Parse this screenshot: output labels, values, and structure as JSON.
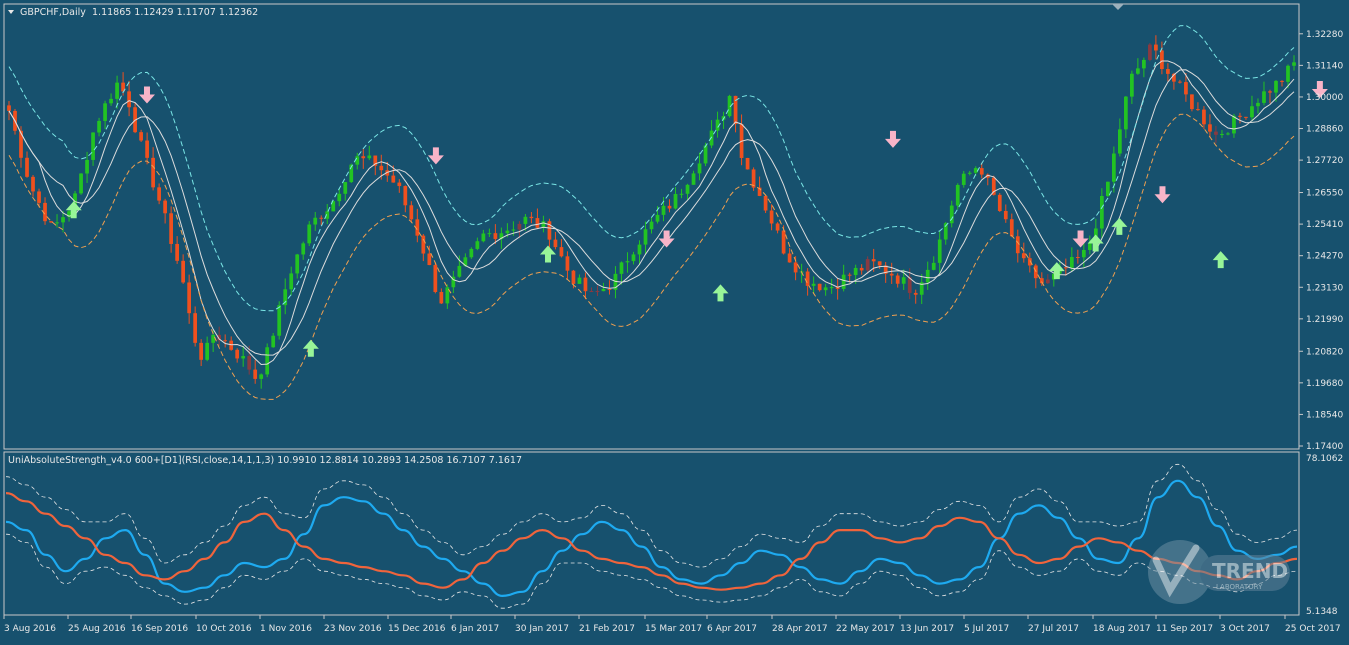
{
  "colors": {
    "background": "#17516e",
    "border": "#c8c8c8",
    "text": "#e8e8e8",
    "bull_candle": "#22c322",
    "bear_candle": "#f0501e",
    "neutral_candle": "#8a3a40",
    "envelope_upper": "#7ae6e6",
    "envelope_lower": "#f0a050",
    "mid_band": "#dcdcdc",
    "arrow_up": "#98f598",
    "arrow_down": "#f8b4c8",
    "strength_bull": "#1eaaf0",
    "strength_bear": "#f0643c",
    "strength_band": "#e6e6e6"
  },
  "header": {
    "dropdown_icon": "triangle-down-icon",
    "symbol_label": "GBPCHF,Daily",
    "ohlc": "1.11865 1.12429 1.11707 1.12362"
  },
  "indicator": {
    "label": "UniAbsoluteStrength_v4.0 600+[D1](RSI,close,14,1,1,3) 10.9910 12.8814 10.2893 14.2508 16.7107 7.1617"
  },
  "watermark": {
    "brand": "TREND",
    "sub": "LABORATORY"
  },
  "chart_data": [
    {
      "type": "candlestick",
      "title": "GBPCHF,Daily",
      "y_ticks": [
        "1.32280",
        "1.31140",
        "1.30000",
        "1.28860",
        "1.27720",
        "1.26550",
        "1.25410",
        "1.24270",
        "1.23130",
        "1.21990",
        "1.20820",
        "1.19680",
        "1.18540",
        "1.17400"
      ],
      "ylim": [
        1.174,
        1.3285
      ],
      "x_ticks": [
        "3 Aug 2016",
        "25 Aug 2016",
        "16 Sep 2016",
        "10 Oct 2016",
        "1 Nov 2016",
        "23 Nov 2016",
        "15 Dec 2016",
        "6 Jan 2017",
        "30 Jan 2017",
        "21 Feb 2017",
        "15 Mar 2017",
        "6 Apr 2017",
        "28 Apr 2017",
        "22 May 2017",
        "13 Jun 2017",
        "5 Jul 2017",
        "27 Jul 2017",
        "18 Aug 2017",
        "11 Sep 2017",
        "3 Oct 2017",
        "25 Oct 2017"
      ],
      "close_path": [
        [
          0,
          1.295
        ],
        [
          1,
          1.268
        ],
        [
          2,
          1.252
        ],
        [
          3,
          1.262
        ],
        [
          4,
          1.29
        ],
        [
          5,
          1.305
        ],
        [
          5.5,
          1.3
        ],
        [
          6,
          1.285
        ],
        [
          7,
          1.262
        ],
        [
          8,
          1.236
        ],
        [
          8.5,
          1.215
        ],
        [
          9,
          1.205
        ],
        [
          9.5,
          1.215
        ],
        [
          10,
          1.212
        ],
        [
          11,
          1.204
        ],
        [
          11.5,
          1.198
        ],
        [
          12,
          1.208
        ],
        [
          13,
          1.236
        ],
        [
          14,
          1.254
        ],
        [
          15,
          1.262
        ],
        [
          16,
          1.278
        ],
        [
          17,
          1.276
        ],
        [
          18,
          1.268
        ],
        [
          19,
          1.25
        ],
        [
          19.5,
          1.238
        ],
        [
          20,
          1.226
        ],
        [
          21,
          1.238
        ],
        [
          22,
          1.25
        ],
        [
          23,
          1.252
        ],
        [
          24,
          1.256
        ],
        [
          25,
          1.252
        ],
        [
          26,
          1.236
        ],
        [
          27,
          1.228
        ],
        [
          28,
          1.233
        ],
        [
          29,
          1.246
        ],
        [
          30,
          1.256
        ],
        [
          31,
          1.264
        ],
        [
          32,
          1.278
        ],
        [
          33,
          1.292
        ],
        [
          33.5,
          1.302
        ],
        [
          34,
          1.278
        ],
        [
          35,
          1.262
        ],
        [
          36,
          1.244
        ],
        [
          37,
          1.234
        ],
        [
          38,
          1.231
        ],
        [
          39,
          1.236
        ],
        [
          40,
          1.24
        ],
        [
          41,
          1.236
        ],
        [
          42,
          1.23
        ],
        [
          43,
          1.244
        ],
        [
          44,
          1.268
        ],
        [
          45,
          1.276
        ],
        [
          46,
          1.258
        ],
        [
          47,
          1.24
        ],
        [
          48,
          1.232
        ],
        [
          49,
          1.238
        ],
        [
          50,
          1.244
        ],
        [
          51,
          1.27
        ],
        [
          52,
          1.306
        ],
        [
          53,
          1.318
        ],
        [
          54,
          1.306
        ],
        [
          55,
          1.296
        ],
        [
          56,
          1.286
        ],
        [
          57,
          1.292
        ],
        [
          58,
          1.3
        ],
        [
          59,
          1.306
        ],
        [
          59.6,
          1.312
        ]
      ],
      "signals": {
        "up": [
          [
            3,
            1.262
          ],
          [
            14,
            1.212
          ],
          [
            25,
            1.246
          ],
          [
            33,
            1.232
          ],
          [
            48.6,
            1.24
          ],
          [
            50.4,
            1.25
          ],
          [
            51.5,
            1.256
          ],
          [
            56.2,
            1.244
          ],
          [
            63,
            1.296
          ]
        ],
        "down": [
          [
            6.4,
            1.298
          ],
          [
            19.8,
            1.276
          ],
          [
            30.5,
            1.246
          ],
          [
            41,
            1.282
          ],
          [
            49.7,
            1.246
          ],
          [
            53.5,
            1.262
          ],
          [
            60.8,
            1.3
          ]
        ]
      }
    },
    {
      "type": "line",
      "title": "UniAbsoluteStrength_v4.0 600+[D1](RSI,close,14,1,1,3)",
      "ylim": [
        5.1348,
        78.1062
      ],
      "y_ticks": [
        "78.1062",
        "5.1348"
      ],
      "series": [
        {
          "values": [
            48,
            44,
            32,
            24,
            30,
            40,
            44,
            32,
            18,
            14,
            16,
            22,
            28,
            26,
            30,
            42,
            56,
            60,
            58,
            52,
            44,
            36,
            30,
            24,
            18,
            12,
            14,
            24,
            34,
            42,
            48,
            44,
            36,
            26,
            20,
            18,
            22,
            28,
            34,
            32,
            26,
            20,
            18,
            24,
            30,
            28,
            22,
            18,
            20,
            26,
            40,
            52,
            56,
            50,
            40,
            30,
            28,
            40,
            60,
            68,
            60,
            46,
            34,
            30,
            32,
            36
          ]
        },
        {
          "values": [
            62,
            58,
            52,
            46,
            40,
            32,
            28,
            22,
            20,
            24,
            30,
            38,
            48,
            52,
            44,
            36,
            30,
            28,
            26,
            24,
            22,
            18,
            16,
            20,
            28,
            34,
            40,
            44,
            40,
            34,
            30,
            28,
            26,
            22,
            18,
            16,
            15,
            16,
            18,
            22,
            30,
            38,
            44,
            44,
            40,
            38,
            40,
            46,
            50,
            48,
            40,
            32,
            28,
            30,
            36,
            40,
            38,
            34,
            30,
            28,
            24,
            22,
            20,
            24,
            28,
            30
          ]
        }
      ]
    }
  ]
}
